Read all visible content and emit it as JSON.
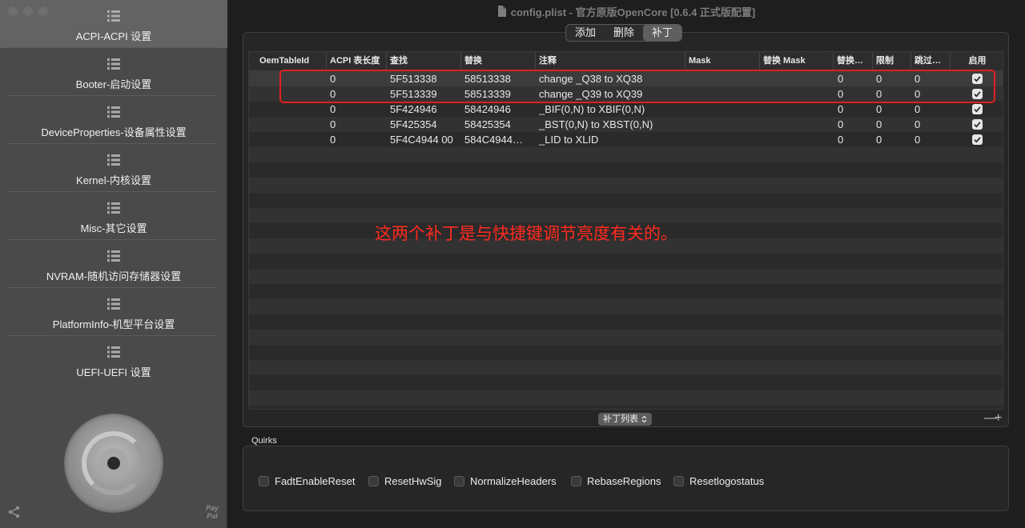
{
  "window": {
    "title": "config.plist - 官方原版OpenCore [0.6.4 正式版配置]"
  },
  "sidebar": {
    "items": [
      {
        "label": "ACPI-ACPI 设置",
        "active": true
      },
      {
        "label": "Booter-启动设置",
        "active": false
      },
      {
        "label": "DeviceProperties-设备属性设置",
        "active": false
      },
      {
        "label": "Kernel-内核设置",
        "active": false
      },
      {
        "label": "Misc-其它设置",
        "active": false
      },
      {
        "label": "NVRAM-随机访问存储器设置",
        "active": false
      },
      {
        "label": "PlatformInfo-机型平台设置",
        "active": false
      },
      {
        "label": "UEFI-UEFI 设置",
        "active": false
      }
    ],
    "paypal_label": "Pay Pal"
  },
  "segmented": {
    "tabs": [
      {
        "label": "添加",
        "active": false
      },
      {
        "label": "删除",
        "active": false
      },
      {
        "label": "补丁",
        "active": true
      }
    ]
  },
  "table": {
    "columns": [
      "OemTableId",
      "ACPI 表长度",
      "查找",
      "替换",
      "注释",
      "Mask",
      "替换 Mask",
      "替换…",
      "限制",
      "跳过…",
      "启用"
    ],
    "rows": [
      {
        "oem": "",
        "length": "0",
        "find": "5F513338",
        "replace": "58513338",
        "comment": "change _Q38 to XQ38",
        "mask": "",
        "replace_mask": "",
        "count": "0",
        "limit": "0",
        "skip": "0",
        "enabled": true
      },
      {
        "oem": "",
        "length": "0",
        "find": "5F513339",
        "replace": "58513339",
        "comment": "change _Q39 to XQ39",
        "mask": "",
        "replace_mask": "",
        "count": "0",
        "limit": "0",
        "skip": "0",
        "enabled": true
      },
      {
        "oem": "",
        "length": "0",
        "find": "5F424946",
        "replace": "58424946",
        "comment": "_BIF(0,N) to XBIF(0,N)",
        "mask": "",
        "replace_mask": "",
        "count": "0",
        "limit": "0",
        "skip": "0",
        "enabled": true
      },
      {
        "oem": "",
        "length": "0",
        "find": "5F425354",
        "replace": "58425354",
        "comment": "_BST(0,N) to XBST(0,N)",
        "mask": "",
        "replace_mask": "",
        "count": "0",
        "limit": "0",
        "skip": "0",
        "enabled": true
      },
      {
        "oem": "",
        "length": "0",
        "find": "5F4C4944 00",
        "replace": "584C4944…",
        "comment": "_LID to XLID",
        "mask": "",
        "replace_mask": "",
        "count": "0",
        "limit": "0",
        "skip": "0",
        "enabled": true
      }
    ],
    "selected_row": 0
  },
  "annotation": {
    "text": "这两个补丁是与快捷键调节亮度有关的。",
    "color": "#ff2a1f"
  },
  "footer": {
    "list_select_label": "补丁列表",
    "minus_label": "—",
    "plus_label": "+"
  },
  "quirks": {
    "title": "Quirks",
    "items": [
      {
        "label": "FadtEnableReset",
        "checked": false
      },
      {
        "label": "ResetHwSig",
        "checked": false
      },
      {
        "label": "NormalizeHeaders",
        "checked": false
      },
      {
        "label": "RebaseRegions",
        "checked": false
      },
      {
        "label": "Resetlogostatus",
        "checked": false
      }
    ]
  }
}
